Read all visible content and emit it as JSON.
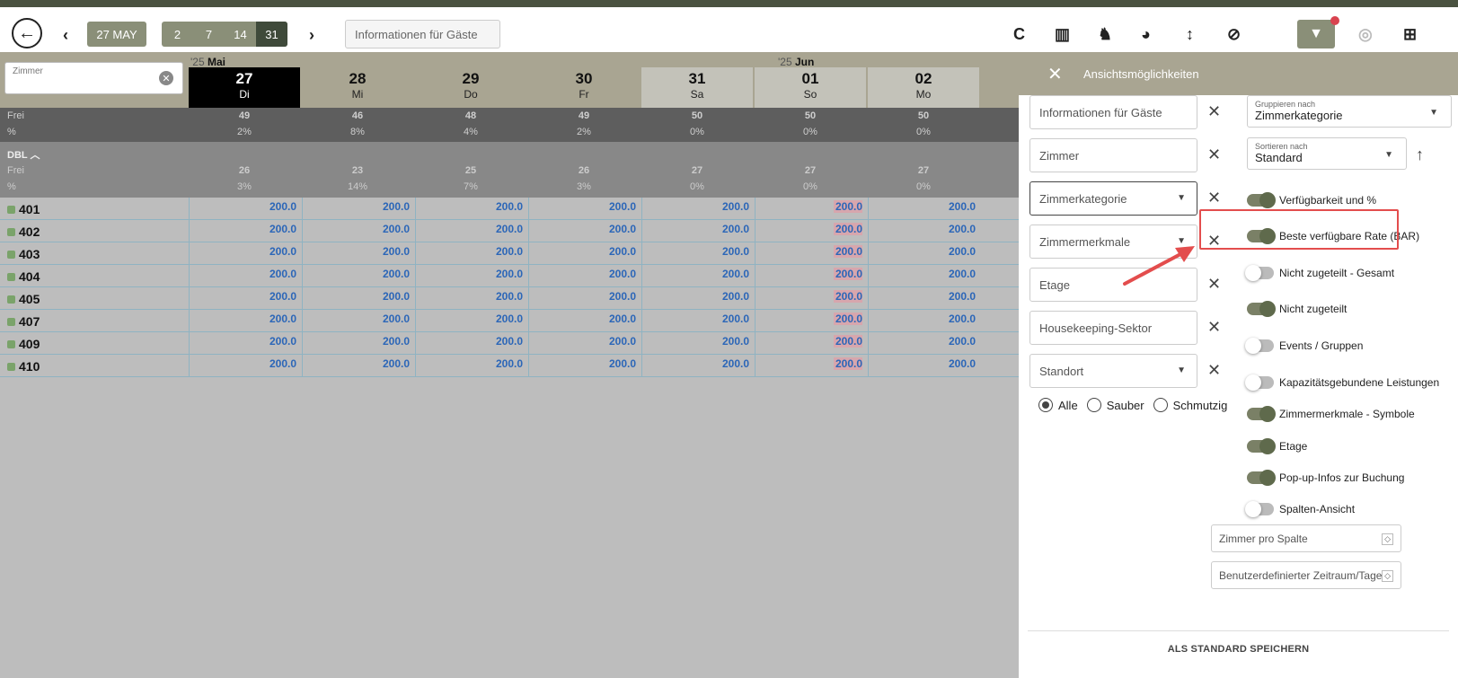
{
  "toolbar": {
    "date": "27 MAY",
    "ranges": [
      "2",
      "7",
      "14",
      "31"
    ],
    "active_range": "31",
    "search_value": "Informationen für Gäste",
    "icons": [
      "refresh-icon",
      "columns-icon",
      "bell-add-icon",
      "palette-icon",
      "sort-vertical-icon",
      "filter-off-icon",
      "filter-icon",
      "focus-icon",
      "settings-list-icon"
    ],
    "icon_glyphs": [
      "C",
      "▥",
      "♞",
      "◕",
      "↕",
      "⊘",
      "▼",
      "◎",
      "⊞"
    ]
  },
  "grid": {
    "room_filter_label": "Zimmer",
    "months": [
      {
        "year": "'25",
        "name": "Mai"
      },
      {
        "year": "'25",
        "name": "Jun"
      }
    ],
    "days": [
      {
        "num": "27",
        "wd": "Di"
      },
      {
        "num": "28",
        "wd": "Mi"
      },
      {
        "num": "29",
        "wd": "Do"
      },
      {
        "num": "30",
        "wd": "Fr"
      },
      {
        "num": "31",
        "wd": "Sa"
      },
      {
        "num": "01",
        "wd": "So"
      },
      {
        "num": "02",
        "wd": "Mo"
      }
    ],
    "free_label": "Frei",
    "pct_label": "%",
    "free_values": [
      "49",
      "46",
      "48",
      "49",
      "50",
      "50",
      "50"
    ],
    "pct_values": [
      "2%",
      "8%",
      "4%",
      "2%",
      "0%",
      "0%",
      "0%"
    ],
    "group_name": "DBL",
    "group_free": [
      "26",
      "23",
      "25",
      "26",
      "27",
      "27",
      "27"
    ],
    "group_pct": [
      "3%",
      "14%",
      "7%",
      "3%",
      "0%",
      "0%",
      "0%"
    ],
    "rooms": [
      "401",
      "402",
      "403",
      "404",
      "405",
      "407",
      "409",
      "410"
    ],
    "rate_value": "200.0"
  },
  "panel": {
    "title": "Ansichtsmöglichkeiten",
    "fields": [
      "Informationen für Gäste",
      "Zimmer",
      "Zimmerkategorie",
      "Zimmermerkmale",
      "Etage",
      "Housekeeping-Sektor",
      "Standort"
    ],
    "radios": [
      "Alle",
      "Sauber",
      "Schmutzig"
    ],
    "group_by": {
      "label": "Gruppieren nach",
      "value": "Zimmerkategorie"
    },
    "sort_by": {
      "label": "Sortieren nach",
      "value": "Standard"
    },
    "toggles": [
      {
        "label": "Verfügbarkeit und %",
        "on": true
      },
      {
        "label": "Beste verfügbare Rate (BAR)",
        "on": true
      },
      {
        "label": "Nicht zugeteilt - Gesamt",
        "on": false
      },
      {
        "label": "Nicht zugeteilt",
        "on": true
      },
      {
        "label": "Events / Gruppen",
        "on": false
      },
      {
        "label": "Kapazitätsgebundene Leistungen",
        "on": false
      },
      {
        "label": "Zimmermerkmale - Symbole",
        "on": true
      },
      {
        "label": "Etage",
        "on": true
      },
      {
        "label": "Pop-up-Infos zur Buchung",
        "on": true
      },
      {
        "label": "Spalten-Ansicht",
        "on": false
      }
    ],
    "rooms_per_column": "Zimmer pro Spalte",
    "custom_range": "Benutzerdefinierter Zeitraum/Tage",
    "save": "ALS STANDARD SPEICHERN"
  }
}
